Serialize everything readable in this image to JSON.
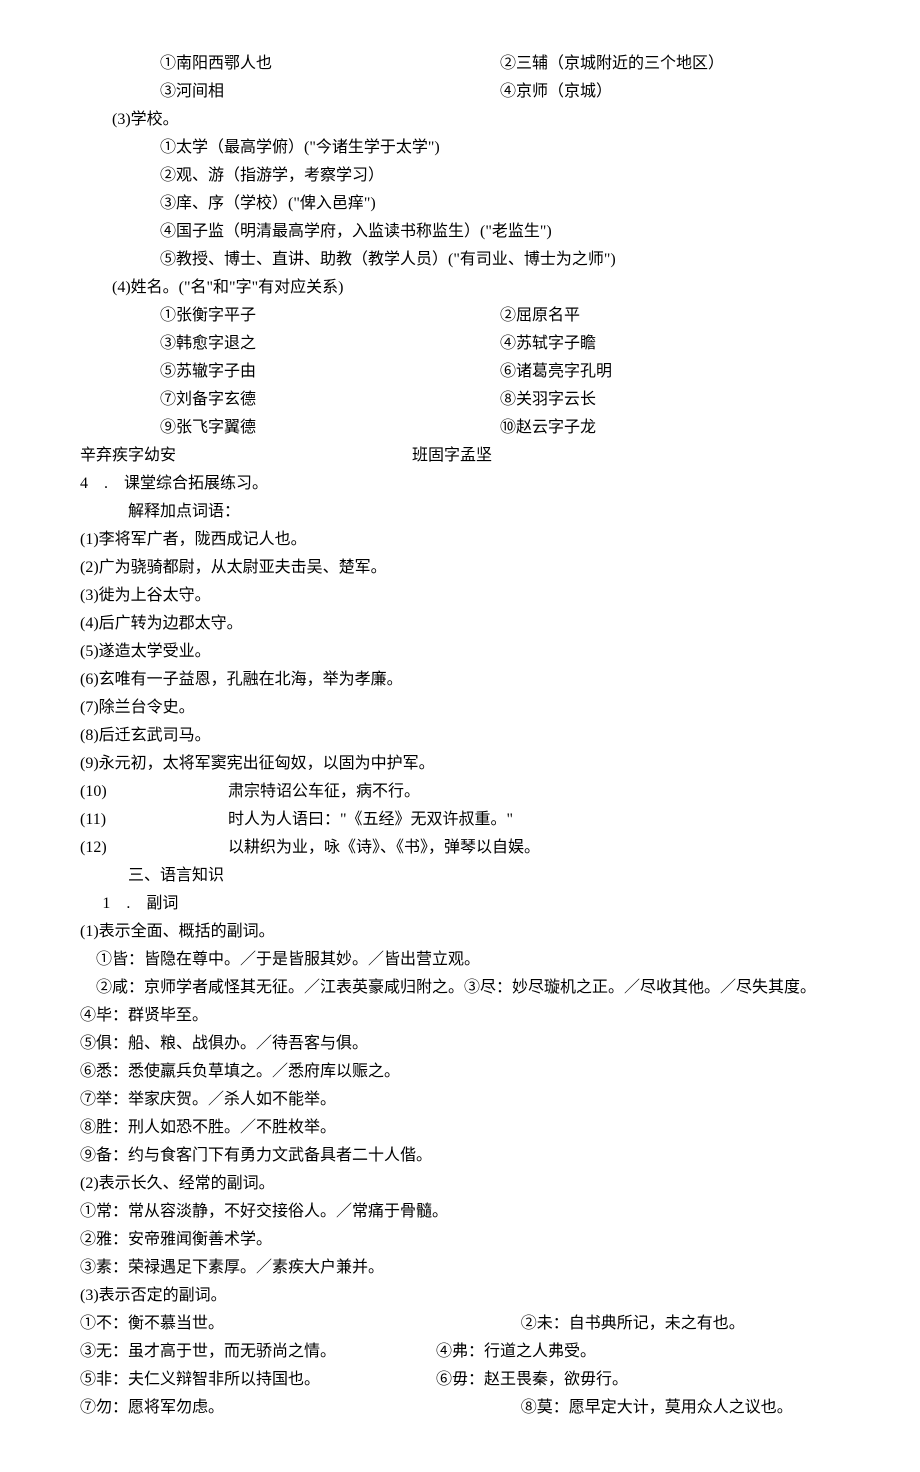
{
  "section2_places": {
    "r1": {
      "a": "①南阳西鄂人也",
      "b": "②三辅（京城附近的三个地区）"
    },
    "r2": {
      "a": "③河间相",
      "b": "④京师（京城）"
    }
  },
  "section3": {
    "heading": "(3)学校。",
    "items": [
      "①太学（最高学俯）(\"今诸生学于太学\")",
      "②观、游（指游学，考察学习）",
      "③庠、序（学校）(\"俾入邑痒\")",
      "④国子监（明清最高学府，入监读书称监生）(\"老监生\")",
      "⑤教授、博士、直讲、助教（教学人员）(\"有司业、博士为之师\")"
    ]
  },
  "section4": {
    "heading": "(4)姓名。(\"名\"和\"字\"有对应关系)",
    "rows": [
      {
        "a": "①张衡字平子",
        "b": "②屈原名平"
      },
      {
        "a": "③韩愈字退之",
        "b": "④苏轼字子瞻"
      },
      {
        "a": "⑤苏辙字子由",
        "b": "⑥诸葛亮字孔明"
      },
      {
        "a": "⑦刘备字玄德",
        "b": "⑧关羽字云长"
      },
      {
        "a": "⑨张飞字翼德",
        "b": "⑩赵云字子龙"
      }
    ],
    "extra": {
      "a": "辛弃疾字幼安",
      "b": "班固字孟坚"
    }
  },
  "exercise": {
    "title": "4　.　课堂综合拓展练习。",
    "subtitle": "解释加点词语：",
    "items": [
      "(1)李将军广者，陇西成记人也。",
      "(2)广为骁骑都尉，从太尉亚夫击吴、楚军。",
      "(3)徙为上谷太守。",
      "(4)后广转为边郡太守。",
      "(5)遂造太学受业。",
      "(6)玄唯有一子益恩，孔融在北海，举为孝廉。",
      "(7)除兰台令史。",
      "(8)后迁玄武司马。",
      "(9)永元初，太将军窦宪出征匈奴，以固为中护军。"
    ],
    "wide_items": [
      {
        "n": "(10)",
        "t": "肃宗特诏公车征，病不行。"
      },
      {
        "n": "(11)",
        "t": "时人为人语曰：\"《五经》无双许叔重。\""
      },
      {
        "n": "(12)",
        "t": "以耕织为业，咏《诗》、《书》，弹琴以自娱。"
      }
    ]
  },
  "lang": {
    "heading": "三、语言知识",
    "sub": "1　.　副词",
    "g1_title": "(1)表示全面、概括的副词。",
    "g1_line1": "　①皆：皆隐在尊中。／于是皆服其妙。／皆出营立观。",
    "g1_line2": "　②咸：京师学者咸怪其无征。／江表英豪咸归附之。③尽：妙尽璇机之正。／尽收其他。／尽失其度。",
    "g1_rest": [
      "④毕：群贤毕至。",
      "⑤俱：船、粮、战俱办。／待吾客与俱。",
      "⑥悉：悉使羸兵负草填之。／悉府库以赈之。",
      "⑦举：举家庆贺。／杀人如不能举。",
      "⑧胜：刑人如恐不胜。／不胜枚举。",
      "⑨备：约与食客门下有勇力文武备具者二十人偕。"
    ],
    "g2_title": "(2)表示长久、经常的副词。",
    "g2_items": [
      "①常：常从容淡静，不好交接俗人。／常痛于骨髓。",
      "②雅：安帝雅闻衡善术学。",
      "③素：荣禄遇足下素厚。／素疾大户兼并。"
    ],
    "g3_title": "(3)表示否定的副词。",
    "g3_r1": {
      "a": "①不：衡不慕当世。",
      "b": "②未：自书典所记，未之有也。"
    },
    "g3_r2": {
      "a": "③无：虽才高于世，而无骄尚之情。",
      "b": "④弗：行道之人弗受。"
    },
    "g3_r3": {
      "a": "⑤非：夫仁义辩智非所以持国也。",
      "b": "⑥毋：赵王畏秦，欲毋行。"
    },
    "g3_r4": {
      "a": "⑦勿：愿将军勿虑。",
      "b": "⑧莫：愿早定大计，莫用众人之议也。"
    }
  }
}
